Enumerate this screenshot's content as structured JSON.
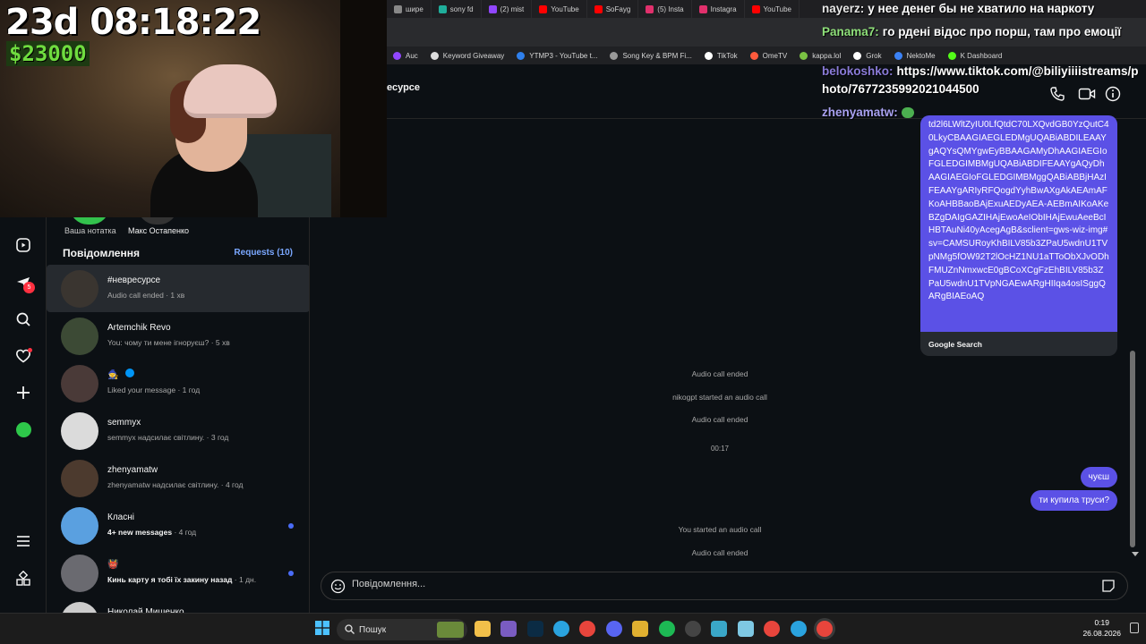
{
  "browser": {
    "tabs": [
      {
        "label": "шире",
        "color": "#888888"
      },
      {
        "label": "sony fd",
        "color": "#1fae9b"
      },
      {
        "label": "(2) mist",
        "color": "#9146ff"
      },
      {
        "label": "YouTube",
        "color": "#ff0000"
      },
      {
        "label": "SoFayg",
        "color": "#ff0000"
      },
      {
        "label": "(5) Insta",
        "color": "#e1306c"
      },
      {
        "label": "Instagra",
        "color": "#e1306c"
      },
      {
        "label": "YouTube",
        "color": "#ff0000"
      }
    ],
    "bookmarks": [
      {
        "label": "Auc",
        "color": "#9146ff"
      },
      {
        "label": "Keyword Giveaway",
        "color": "#dddddd"
      },
      {
        "label": "YTMP3 - YouTube t...",
        "color": "#2f80ed"
      },
      {
        "label": "Song Key & BPM Fi...",
        "color": "#999999"
      },
      {
        "label": "TikTok",
        "color": "#ffffff"
      },
      {
        "label": "OmeTV",
        "color": "#ff5a3c"
      },
      {
        "label": "kappa.lol",
        "color": "#7ac143"
      },
      {
        "label": "Grok",
        "color": "#ffffff"
      },
      {
        "label": "NektoMe",
        "color": "#3b82f6"
      },
      {
        "label": "K Dashboard",
        "color": "#53fc18"
      }
    ]
  },
  "stream_overlay": {
    "uptime": "23d 08:18:22",
    "money": "$23000",
    "chat": [
      {
        "user": "nayerz:",
        "text": "у нее денег бы не хватило на наркоту",
        "color": "#e6e6e6"
      },
      {
        "user": "Panama7:",
        "text": "го рдені відос про порш, там про емоції",
        "color": "#8fe07a"
      },
      {
        "user": "belokoshko:",
        "text": "https://www.tiktok.com/@biliyiiiistreams/p",
        "color": "#8a7bd8"
      },
      {
        "user": "",
        "text": "hoto/7677235992021044500",
        "color": "#ffffff"
      },
      {
        "user": "zhenyamatw:",
        "text": "",
        "color": "#a9a1f0"
      }
    ]
  },
  "nav": {
    "icons": [
      "reels-icon",
      "messages-icon",
      "search-icon",
      "notifications-icon",
      "create-icon",
      "profile-icon",
      "menu-icon",
      "more-icon"
    ],
    "messages_badge": "5"
  },
  "inbox": {
    "notes": [
      {
        "label": "Ваша нотатка"
      },
      {
        "label": "Макс Остапенко"
      }
    ],
    "heading": "Повідомлення",
    "requests": "Requests (10)",
    "conversations": [
      {
        "name": "#невресурсе",
        "sub": "Audio call ended",
        "time": "· 1 хв",
        "unread": false,
        "color": "#3a3530"
      },
      {
        "name": "Artemchik Revo",
        "sub": "You: чому ти мене ігноруєш?",
        "time": "· 5 хв",
        "unread": false,
        "color": "#3c4a35"
      },
      {
        "name": "🧙",
        "sub": "Liked your message",
        "time": "· 1 год",
        "unread": false,
        "color": "#4a3a38"
      },
      {
        "name": "semmyx",
        "sub": "semmyx надсилає світлину.",
        "time": "· 3 год",
        "unread": false,
        "color": "#dbdbdb"
      },
      {
        "name": "zhenyamatw",
        "sub": "zhenyamatw надсилає світлину.",
        "time": "· 4 год",
        "unread": false,
        "color": "#4c3a2e"
      },
      {
        "name": "Класні",
        "sub": "4+ new messages",
        "time": "· 4 год",
        "unread": true,
        "color": "#5aa0e0"
      },
      {
        "name": "👹",
        "sub": "Кинь карту я тобі їх закину назад",
        "time": "· 1 дн.",
        "unread": true,
        "color": "#6a6a70"
      },
      {
        "name": "Николай Мищенко",
        "sub": "",
        "time": "",
        "unread": false,
        "color": "#cccccc"
      }
    ]
  },
  "chat": {
    "title": "есурсе",
    "shared_card": {
      "text": "td2l6LWltZyIU0LfQtdC70LXQvdGB0YzQutC40LkyCBAAGIAEGLEDMgUQABiABDILEAAYgAQYsQMYgwEyBBAAGAMyDhAAGIAEGIoFGLEDGIMBMgUQABiABDIFEAAYgAQyDhAAGIAEGIoFGLEDGIMBMggQABiABBjHAzIFEAAYgARIyRFQogdYyhBwAXgAkAEAmAFKoAHBBaoBAjExuAEDyAEA-AEBmAIKoAKeBZgDAIgGAZIHAjEwoAeIObIHAjEwuAeeBcIHBTAuNi40yAcegAgB&sclient=gws-wiz-img#sv=CAMSURoyKhBILV85b3ZPaU5wdnU1TVpNMg5fOW92T2lOcHZ1NU1aTToObXJvODhFMUZnNmxwcE0gBCoXCgFzEhBILV85b3ZPaU5wdnU1TVpNGAEwARgHIIqa4osISggQARgBIAEoAQ",
      "source": "Google Search"
    },
    "events": [
      "Audio call ended",
      "nikogpt started an audio call",
      "Audio call ended",
      "00:17"
    ],
    "outgoing": [
      "чуєш",
      "ти купила труси?"
    ],
    "events2": [
      "You started an audio call",
      "Audio call ended"
    ],
    "composer_placeholder": "Повідомлення..."
  },
  "taskbar": {
    "search_label": "Пошук",
    "time": "0:19",
    "date": "26.08.2026"
  }
}
